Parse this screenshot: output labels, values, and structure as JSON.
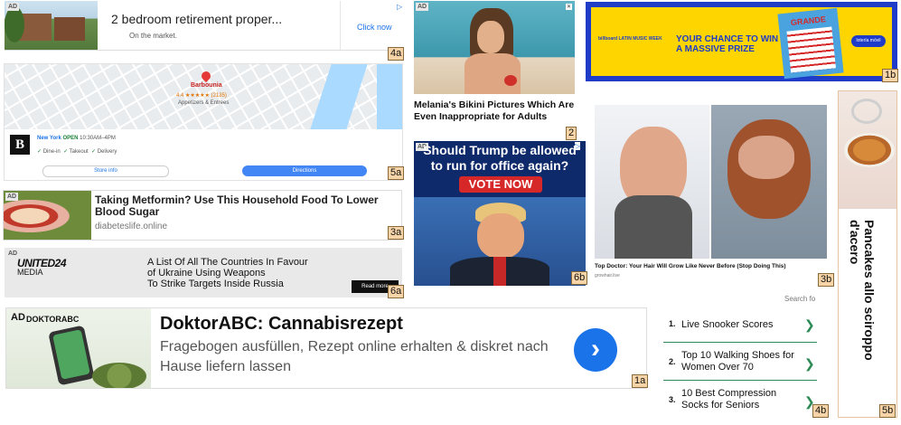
{
  "labels": {
    "l4a": "4a",
    "l2": "2",
    "l1b": "1b",
    "l5a": "5a",
    "l3a": "3a",
    "l6a": "6a",
    "l6b": "6b",
    "l3b": "3b",
    "l1a": "1a",
    "l4b": "4b",
    "l5b": "5b"
  },
  "ad4a": {
    "badge": "AD",
    "title": "2 bedroom retirement proper...",
    "subtitle": "On the market.",
    "cta": "Click now"
  },
  "ad2": {
    "badge": "AD",
    "caption": "Melania's Bikini Pictures Which Are Even Inappropriate for Adults"
  },
  "ad1b": {
    "brand": "billboard LATIN MUSIC WEEK",
    "headline1": "YOUR CHANCE TO WIN",
    "headline2": "A MASSIVE PRIZE",
    "ticket": "GRANDE",
    "sponsor": "lotería móvil"
  },
  "ad5a": {
    "place": "Barbounia",
    "rating": "4.4 ★★★★★ (2135)",
    "category": "Appetizers & Entrees",
    "city": "New York",
    "status": "OPEN",
    "hours": "10:30AM–4PM",
    "features": [
      "Dine-in",
      "Takeout",
      "Delivery"
    ],
    "store_info": "Store info",
    "directions": "Directions",
    "logo_letter": "B"
  },
  "ad3a": {
    "badge": "AD",
    "title": "Taking Metformin? Use This Household Food To Lower Blood Sugar",
    "domain": "diabeteslife.online"
  },
  "ad6a": {
    "badge": "AD",
    "brand": "UNITED24",
    "brand_sub": "MEDIA",
    "line1": "A List Of All The Countries In Favour",
    "line2": "of Ukraine Using Weapons",
    "line3": "To Strike Targets Inside Russia",
    "cta": "Read more"
  },
  "ad6b": {
    "badge": "AD",
    "line1": "Should Trump be allowed",
    "line2": "to run for office again?",
    "cta": "VOTE NOW"
  },
  "ad3b": {
    "caption": "Top Doctor: Your Hair Will Grow Like Never Before (Stop Doing This)",
    "domain": "growhair.live"
  },
  "ad1a": {
    "badge": "AD",
    "brand": "DOKTORABC",
    "title": "DoktorABC: Cannabisrezept",
    "body": "Fragebogen ausfüllen, Rezept online erhalten & diskret nach Hause liefern lassen"
  },
  "ad4b": {
    "search_label": "Search fo",
    "items": [
      {
        "num": "1.",
        "text": "Live Snooker Scores"
      },
      {
        "num": "2.",
        "text": "Top 10 Walking Shoes for Women Over 70"
      },
      {
        "num": "3.",
        "text": "10 Best Compression Socks for Seniors"
      }
    ]
  },
  "ad5b": {
    "caption": "Pancakes allo sciroppo d'acero"
  }
}
